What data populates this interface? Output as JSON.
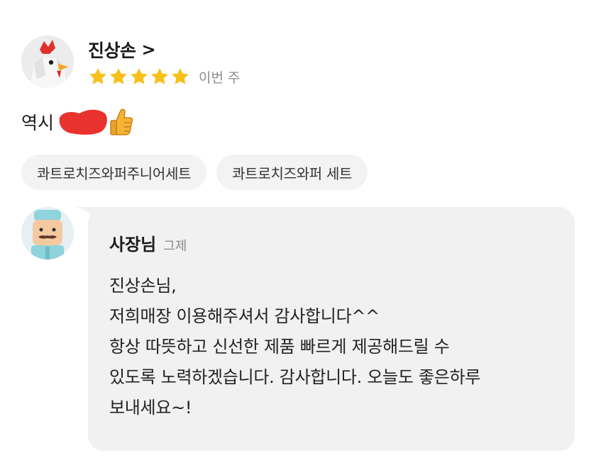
{
  "review": {
    "reviewer_name": "진상손",
    "chevron": ">",
    "rating": 5,
    "rating_max": 5,
    "date": "이번 주",
    "text": "역시",
    "menu_chips": [
      "콰트로치즈와퍼주니어세트",
      "콰트로치즈와퍼 세트"
    ]
  },
  "reply": {
    "owner_name": "사장님",
    "date": "그제",
    "lines": [
      "진상손님,",
      "저희매장 이용해주셔서 감사합니다^^",
      "항상 따뜻하고 신선한 제품 빠르게 제공해드릴 수",
      "있도록 노력하겠습니다. 감사합니다. 오늘도 좋은하루",
      "보내세요~!"
    ]
  },
  "colors": {
    "star": "#f7c01b",
    "redaction": "#e8322e",
    "bubble_bg": "#f1f1f1",
    "chip_bg": "#f3f3f3",
    "muted_text": "#8a8a8a"
  },
  "icons": {
    "reviewer_avatar": "chicken-avatar-icon",
    "owner_avatar": "chef-avatar-icon",
    "reaction": "thumbs-up-icon",
    "star": "star-icon"
  }
}
